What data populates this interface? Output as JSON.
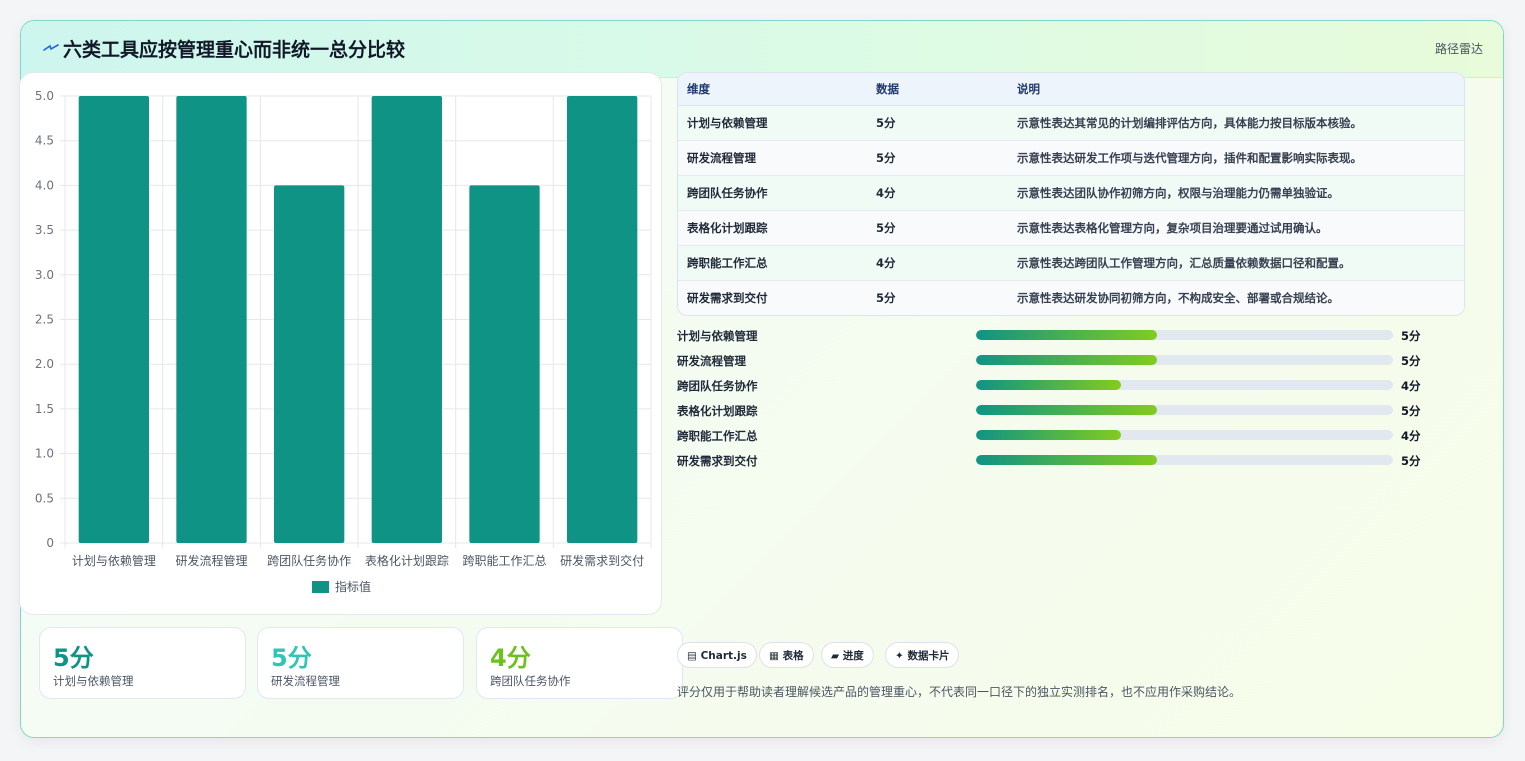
{
  "header": {
    "title": "六类工具应按管理重心而非统一总分比较",
    "tag": "路径雷达",
    "icon": "bolt-icon"
  },
  "chart_data": {
    "type": "bar",
    "categories": [
      "计划与依赖管理",
      "研发流程管理",
      "跨团队任务协作",
      "表格化计划跟踪",
      "跨职能工作汇总",
      "研发需求到交付"
    ],
    "series": [
      {
        "name": "指标值",
        "values": [
          5,
          5,
          4,
          5,
          4,
          5
        ],
        "color": "#0e9384"
      }
    ],
    "yticks": [
      "0",
      "0.5",
      "1.0",
      "1.5",
      "2.0",
      "2.5",
      "3.0",
      "3.5",
      "4.0",
      "4.5",
      "5.0"
    ],
    "ylim": [
      0,
      5
    ],
    "legend": "bottom",
    "grid": true
  },
  "kpis": [
    {
      "value": "5分",
      "label": "计划与依赖管理",
      "color": "#0e9384"
    },
    {
      "value": "5分",
      "label": "研发流程管理",
      "color": "#2ec4b6"
    },
    {
      "value": "4分",
      "label": "跨团队任务协作",
      "color": "#6cc11e"
    }
  ],
  "table": {
    "headers": [
      "维度",
      "数据",
      "说明"
    ],
    "rows": [
      [
        "计划与依赖管理",
        "5分",
        "示意性表达其常见的计划编排评估方向，具体能力按目标版本核验。"
      ],
      [
        "研发流程管理",
        "5分",
        "示意性表达研发工作项与迭代管理方向，插件和配置影响实际表现。"
      ],
      [
        "跨团队任务协作",
        "4分",
        "示意性表达团队协作初筛方向，权限与治理能力仍需单独验证。"
      ],
      [
        "表格化计划跟踪",
        "5分",
        "示意性表达表格化管理方向，复杂项目治理要通过试用确认。"
      ],
      [
        "跨职能工作汇总",
        "4分",
        "示意性表达跨团队工作管理方向，汇总质量依赖数据口径和配置。"
      ],
      [
        "研发需求到交付",
        "5分",
        "示意性表达研发协同初筛方向，不构成安全、部署或合规结论。"
      ]
    ]
  },
  "progress": {
    "max": 5,
    "items": [
      {
        "label": "计划与依赖管理",
        "value": 5,
        "text": "5分"
      },
      {
        "label": "研发流程管理",
        "value": 5,
        "text": "5分"
      },
      {
        "label": "跨团队任务协作",
        "value": 4,
        "text": "4分"
      },
      {
        "label": "表格化计划跟踪",
        "value": 5,
        "text": "5分"
      },
      {
        "label": "跨职能工作汇总",
        "value": 4,
        "text": "4分"
      },
      {
        "label": "研发需求到交付",
        "value": 5,
        "text": "5分"
      }
    ]
  },
  "chips": [
    {
      "label": "▤ Chart.js",
      "icon": "chart-icon"
    },
    {
      "label": "▦ 表格",
      "icon": "table-icon"
    },
    {
      "label": "▰ 进度",
      "icon": "progress-icon"
    },
    {
      "label": "✦ 数据卡片",
      "icon": "sparkle-icon"
    }
  ],
  "note": "评分仅用于帮助读者理解候选产品的管理重心，不代表同一口径下的独立实测排名，也不应用作采购结论。"
}
